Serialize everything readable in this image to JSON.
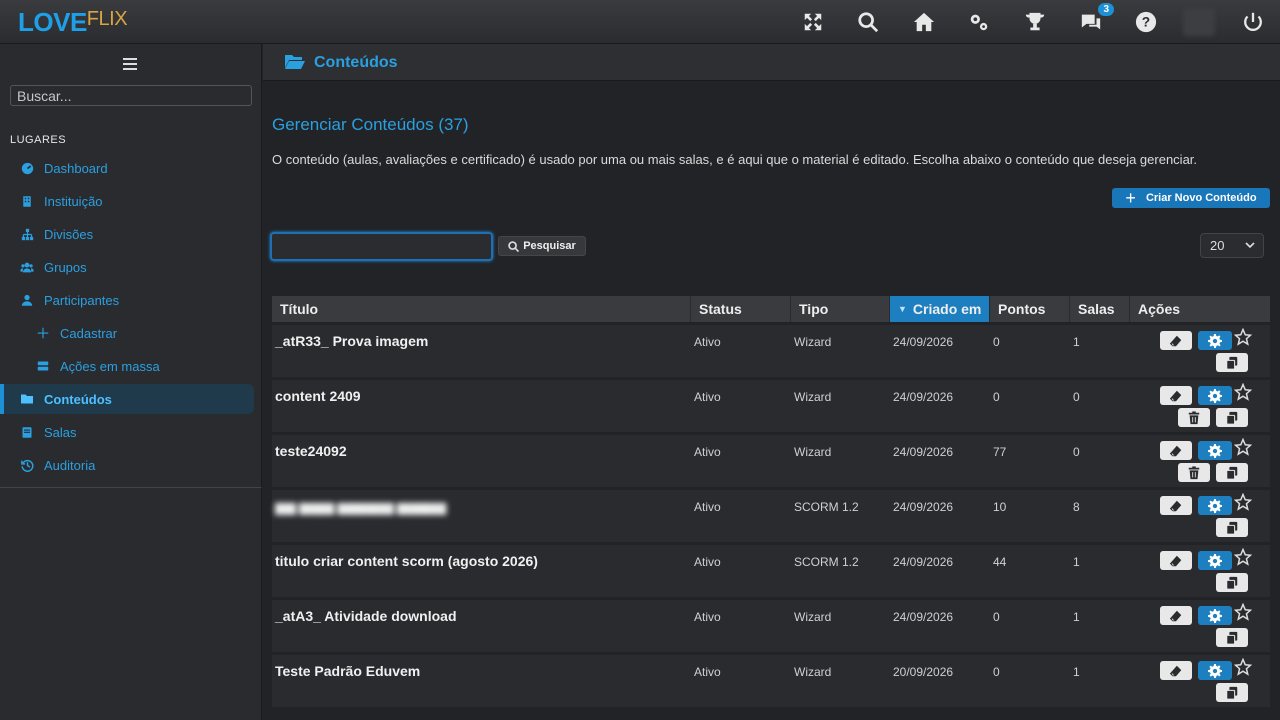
{
  "app": {
    "logo_love": "LOVE",
    "logo_flix": "FLIX",
    "notifications_count": "3"
  },
  "topbar_icons": [
    "fullscreen-icon",
    "search-icon",
    "home-icon",
    "settings-icon",
    "trophy-icon",
    "chat-icon",
    "help-icon",
    "power-icon"
  ],
  "sidebar": {
    "search_placeholder": "Buscar...",
    "section_title": "LUGARES",
    "items": [
      {
        "label": "Dashboard",
        "icon": "dashboard-icon"
      },
      {
        "label": "Instituição",
        "icon": "building-icon"
      },
      {
        "label": "Divisões",
        "icon": "sitemap-icon"
      },
      {
        "label": "Grupos",
        "icon": "users-icon"
      },
      {
        "label": "Participantes",
        "icon": "user-icon"
      },
      {
        "label": "Cadastrar",
        "icon": "plus-icon"
      },
      {
        "label": "Ações em massa",
        "icon": "bulk-icon"
      },
      {
        "label": "Conteúdos",
        "icon": "folder-icon"
      },
      {
        "label": "Salas",
        "icon": "book-icon"
      },
      {
        "label": "Auditoria",
        "icon": "history-icon"
      }
    ]
  },
  "header": {
    "title": "Conteúdos"
  },
  "main": {
    "title": "Gerenciar Conteúdos (37)",
    "description": "O conteúdo (aulas, avaliações e certificado) é usado por uma ou mais salas, e é aqui que o material é editado. Escolha abaixo o conteúdo que deseja gerenciar.",
    "create_button": "Criar Novo Conteúdo",
    "search_value": "",
    "search_button": "Pesquisar",
    "page_size": "20"
  },
  "table": {
    "columns": [
      "Título",
      "Status",
      "Tipo",
      "Criado em",
      "Pontos",
      "Salas",
      "Ações"
    ],
    "sorted_column": "Criado em",
    "rows": [
      {
        "title": "_atR33_ Prova imagem",
        "status": "Ativo",
        "type": "Wizard",
        "created": "24/09/2026",
        "points": "0",
        "rooms": "1",
        "delete": false,
        "blurred": false
      },
      {
        "title": "content 2409",
        "status": "Ativo",
        "type": "Wizard",
        "created": "24/09/2026",
        "points": "0",
        "rooms": "0",
        "delete": true,
        "blurred": false
      },
      {
        "title": "teste24092",
        "status": "Ativo",
        "type": "Wizard",
        "created": "24/09/2026",
        "points": "77",
        "rooms": "0",
        "delete": true,
        "blurred": false
      },
      {
        "title": "",
        "status": "Ativo",
        "type": "SCORM 1.2",
        "created": "24/09/2026",
        "points": "10",
        "rooms": "8",
        "delete": false,
        "blurred": true
      },
      {
        "title": "titulo criar content scorm (agosto 2026)",
        "status": "Ativo",
        "type": "SCORM 1.2",
        "created": "24/09/2026",
        "points": "44",
        "rooms": "1",
        "delete": false,
        "blurred": false
      },
      {
        "title": "_atA3_ Atividade download",
        "status": "Ativo",
        "type": "Wizard",
        "created": "24/09/2026",
        "points": "0",
        "rooms": "1",
        "delete": false,
        "blurred": false
      },
      {
        "title": "Teste Padrão Eduvem",
        "status": "Ativo",
        "type": "Wizard",
        "created": "20/09/2026",
        "points": "0",
        "rooms": "1",
        "delete": false,
        "blurred": false
      }
    ]
  },
  "colors": {
    "accent": "#1e90d6",
    "text_link": "#2aa0e0",
    "background": "#222326"
  }
}
